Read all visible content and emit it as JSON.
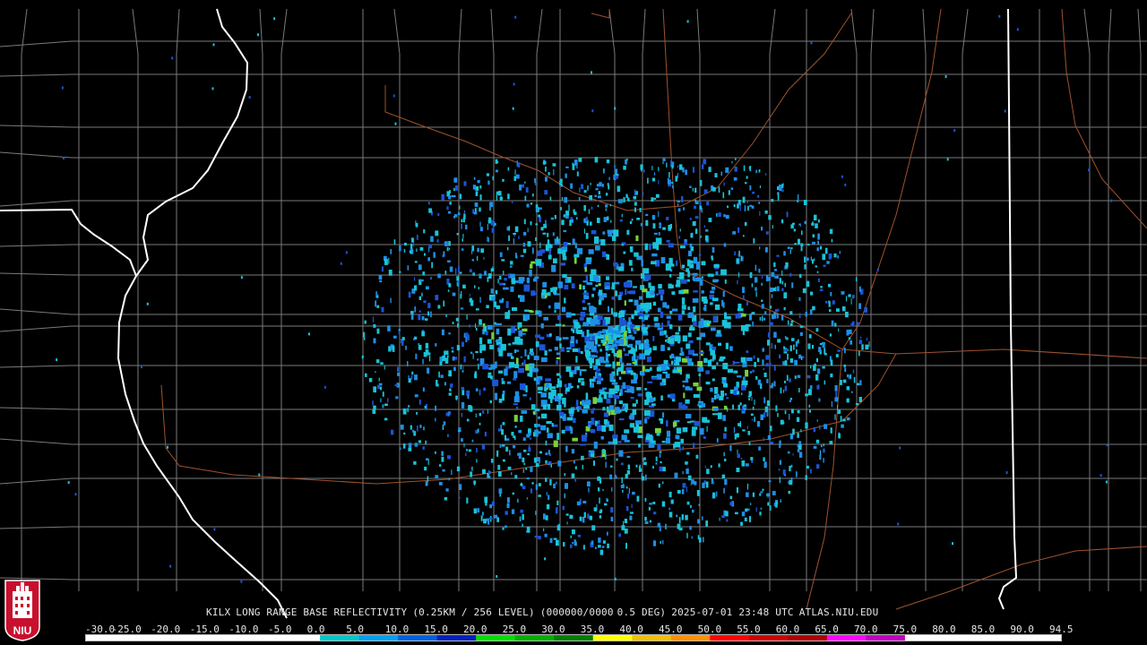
{
  "product": {
    "station": "KILX",
    "product_name": "LONG RANGE BASE REFLECTIVITY",
    "resolution": "(0.25KM / 256 LEVEL)",
    "volume": "(000000/0000",
    "elevation": "0.5 DEG)",
    "datetime": "2025-07-01 23:48 UTC",
    "source": "ATLAS.NIU.EDU"
  },
  "logo": {
    "text": "NIU",
    "colors": {
      "red": "#c8102e",
      "white": "#ffffff"
    }
  },
  "scale": {
    "labels": [
      "-30.0",
      "-25.0",
      "-20.0",
      "-15.0",
      "-10.0",
      "-5.0",
      "0.0",
      "5.0",
      "10.0",
      "15.0",
      "20.0",
      "25.0",
      "30.0",
      "35.0",
      "40.0",
      "45.0",
      "50.0",
      "55.0",
      "60.0",
      "65.0",
      "70.0",
      "75.0",
      "80.0",
      "85.0",
      "90.0",
      "94.5"
    ],
    "colors": [
      "#ffffff",
      "#ffffff",
      "#ffffff",
      "#ffffff",
      "#ffffff",
      "#ffffff",
      "#00c8c8",
      "#00a0f0",
      "#0060e0",
      "#0020c0",
      "#00e000",
      "#00b000",
      "#008000",
      "#ffff00",
      "#f0c000",
      "#ff9000",
      "#ff0000",
      "#d00000",
      "#b00000",
      "#ff00ff",
      "#c000c0",
      "#ffffff",
      "#ffffff",
      "#ffffff",
      "#ffffff"
    ]
  },
  "map_colors": {
    "background": "#000000",
    "county_lines": "#7a7a7a",
    "state_lines": "#ffffff",
    "roads": "#a0522d",
    "echo_light": "#19c3d8",
    "echo_mid": "#1e8fe6",
    "echo_dark": "#1b55d6",
    "echo_green": "#7ad13a"
  }
}
